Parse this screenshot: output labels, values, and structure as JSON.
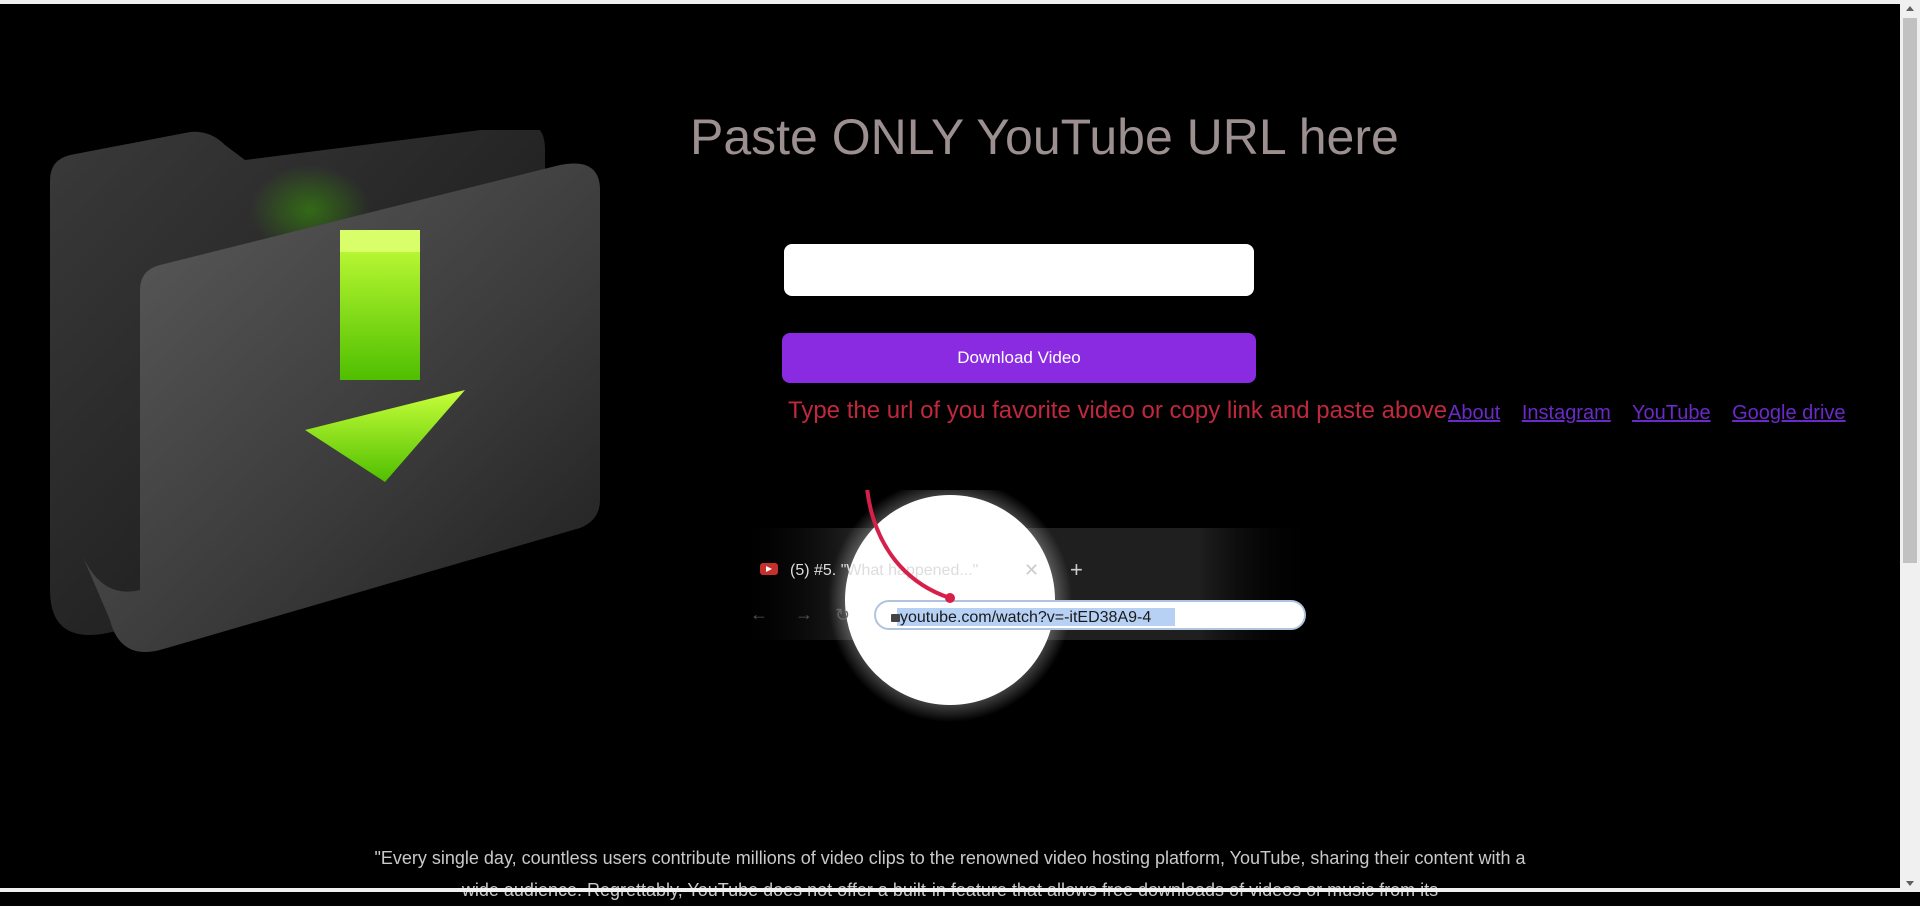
{
  "headline": "Paste ONLY YouTube URL here",
  "url_input": {
    "value": "",
    "placeholder": ""
  },
  "download_button": "Download Video",
  "hint": "Type the url of you favorite video or copy link and paste above",
  "nav": {
    "about": "About",
    "instagram": "Instagram",
    "youtube": "YouTube",
    "google_drive": "Google drive"
  },
  "demo": {
    "tab_title": "(5) #5. \"What happened...\"",
    "address": "youtube.com/watch?v=-itED38A9-4",
    "close_symbol": "✕",
    "newtab_symbol": "+"
  },
  "quote": "\"Every single day, countless users contribute millions of video clips to the renowned video hosting platform, YouTube, sharing their content with a wide audience. Regrettably, YouTube does not offer a built-in feature that allows free downloads of videos or music from its",
  "colors": {
    "accent": "#8a2be2",
    "hint": "#c0283d",
    "link": "#6a2ac8",
    "headline": "#9b8f8f",
    "arrow_green": "#9bef00"
  }
}
